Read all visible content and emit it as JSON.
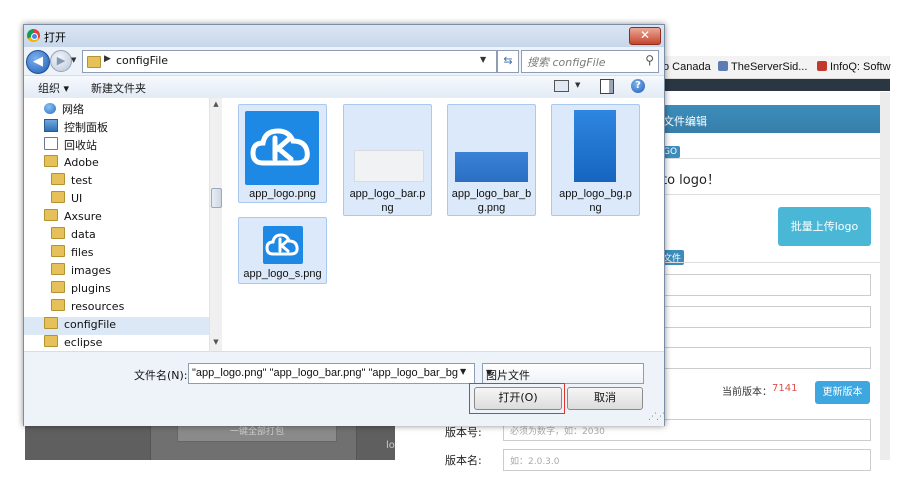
{
  "dialog": {
    "title": "打开",
    "close_label": "✕",
    "address": {
      "path_segment": "configFile"
    },
    "search": {
      "placeholder": "搜索 configFile"
    },
    "toolbar": {
      "organize_label": "组织 ▾",
      "new_folder_label": "新建文件夹",
      "help_label": "?"
    },
    "nav_tree": [
      {
        "label": "网络",
        "icon": "network-icon"
      },
      {
        "label": "控制面板",
        "icon": "control-panel-icon"
      },
      {
        "label": "回收站",
        "icon": "recycle-bin-icon"
      },
      {
        "label": "Adobe",
        "icon": "folder-icon"
      },
      {
        "label": "test",
        "icon": "folder-icon"
      },
      {
        "label": "UI",
        "icon": "folder-icon"
      },
      {
        "label": "Axsure",
        "icon": "folder-icon"
      },
      {
        "label": "data",
        "icon": "folder-icon"
      },
      {
        "label": "files",
        "icon": "folder-icon"
      },
      {
        "label": "images",
        "icon": "folder-icon"
      },
      {
        "label": "plugins",
        "icon": "folder-icon"
      },
      {
        "label": "resources",
        "icon": "folder-icon"
      },
      {
        "label": "configFile",
        "icon": "folder-icon",
        "selected": true
      },
      {
        "label": "eclipse",
        "icon": "folder-icon"
      }
    ],
    "files": [
      {
        "name_line1": "app_logo.png",
        "name_line2": "",
        "selected": true
      },
      {
        "name_line1": "app_logo_bar.p",
        "name_line2": "ng",
        "selected": true
      },
      {
        "name_line1": "app_logo_bar_b",
        "name_line2": "g.png",
        "selected": true
      },
      {
        "name_line1": "app_logo_bg.p",
        "name_line2": "ng",
        "selected": true
      },
      {
        "name_line1": "app_logo_s.png",
        "name_line2": "",
        "selected": true
      }
    ],
    "filename_label": "文件名(N):",
    "filename_value": "\"app_logo.png\" \"app_logo_bar.png\" \"app_logo_bar_bg",
    "filetype_value": "图片文件",
    "open_label": "打开(O)",
    "cancel_label": "取消"
  },
  "background_page": {
    "bookmarks": [
      "o Canada",
      "TheServerSid...",
      "InfoQ: Softw"
    ],
    "panel_title": "文件编辑",
    "logo_badge": "GO",
    "info_text": "to logo！",
    "upload_button": "批量上传logo",
    "files_badge": "文件",
    "current_version_label": "当前版本：",
    "current_version_value": "7141",
    "update_button": "更新版本",
    "version_number_label": "版本号:",
    "version_number_placeholder": "必须为数字，如：2030",
    "version_name_label": "版本名:",
    "version_name_placeholder": "如：2.0.3.0",
    "pack_all_button": "一键全部打包",
    "partial_text": "lo"
  }
}
